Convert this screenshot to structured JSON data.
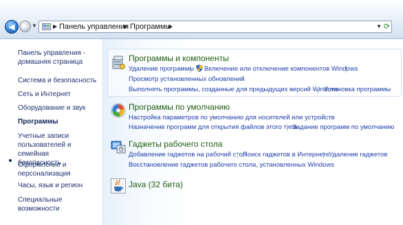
{
  "address_bar": {
    "breadcrumbs": [
      "Панель управления",
      "Программы"
    ]
  },
  "sidebar": {
    "items": [
      {
        "label": "Панель управления -\nдомашняя страница"
      },
      {
        "label": "Система и безопасность"
      },
      {
        "label": "Сеть и Интернет"
      },
      {
        "label": "Оборудование и звук"
      },
      {
        "label": "Программы",
        "active": true
      },
      {
        "label": "Учетные записи\nпользователей и семейная\nбезопасность"
      },
      {
        "label": "Оформление и\nперсонализация"
      },
      {
        "label": "Часы, язык и регион"
      },
      {
        "label": "Специальные возможности"
      }
    ]
  },
  "categories": [
    {
      "title": "Программы и компоненты",
      "links": [
        "Удаление программы",
        "Включение или отключение компонентов Windows",
        "Просмотр установленных обновлений",
        "Выполнять программы, созданные для предыдущих версий Windows",
        "Установка программы"
      ]
    },
    {
      "title": "Программы по умолчанию",
      "links": [
        "Настройка параметров по умолчанию для носителей или устройств",
        "Назначение программ для открытия файлов этого типа",
        "Задание программ по умолчанию"
      ]
    },
    {
      "title": "Гаджеты рабочего стола",
      "links": [
        "Добавление гаджетов на рабочий стол",
        "Поиск гаджетов в Интернете",
        "Удаление гаджетов",
        "Восстановление гаджетов рабочего стола, установленных Windows"
      ]
    },
    {
      "title": "Java (32 бита)",
      "links": []
    }
  ],
  "colors": {
    "category_title": "#1e5b0e",
    "link": "#1f3ea8",
    "sidebar_text": "#1b2f6e"
  }
}
